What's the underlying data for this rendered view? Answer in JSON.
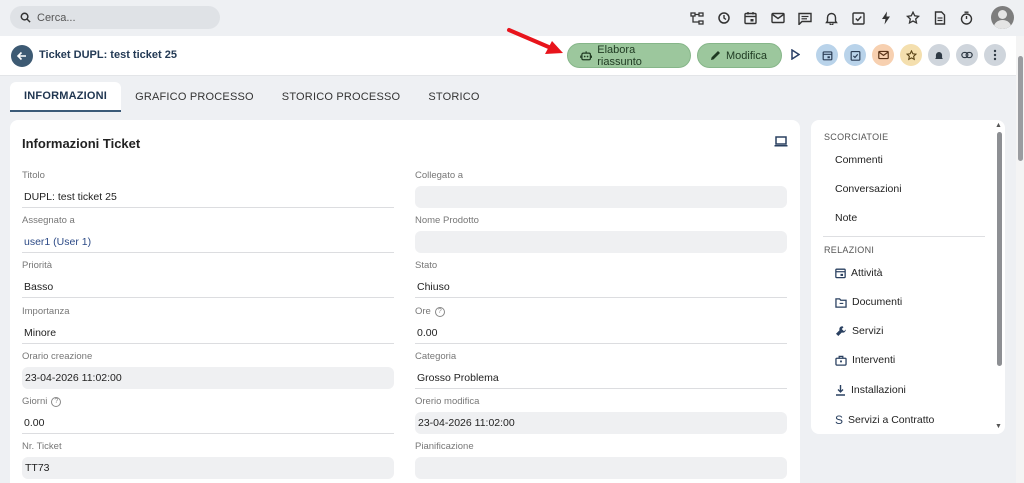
{
  "topbar": {
    "search_placeholder": "Cerca...",
    "icons": [
      "sitemap-icon",
      "history-icon",
      "calendar-icon",
      "mail-icon",
      "chat-icon",
      "bell-icon",
      "task-check-icon",
      "bolt-icon",
      "star-icon",
      "document-icon",
      "timer-icon"
    ]
  },
  "header": {
    "title": "Ticket DUPL: test ticket 25",
    "summary_button": "Elabora riassunto",
    "edit_button": "Modifica"
  },
  "tabs": [
    "INFORMAZIONI",
    "GRAFICO PROCESSO",
    "STORICO PROCESSO",
    "STORICO"
  ],
  "card": {
    "title": "Informazioni Ticket",
    "left_fields": [
      {
        "label": "Titolo",
        "value": "DUPL: test ticket 25"
      },
      {
        "label": "Assegnato a",
        "value": "user1 (User 1)"
      },
      {
        "label": "Priorità",
        "value": "Basso"
      },
      {
        "label": "Importanza",
        "value": "Minore"
      },
      {
        "label": "Orario creazione",
        "value": "23-04-2026 11:02:00"
      },
      {
        "label": "Giorni",
        "value": "0.00"
      },
      {
        "label": "Nr. Ticket",
        "value": "TT73"
      }
    ],
    "right_fields": [
      {
        "label": "Collegato a",
        "value": ""
      },
      {
        "label": "Nome Prodotto",
        "value": ""
      },
      {
        "label": "Stato",
        "value": "Chiuso"
      },
      {
        "label": "Ore",
        "value": "0.00"
      },
      {
        "label": "Categoria",
        "value": "Grosso Problema"
      },
      {
        "label": "Orerio modifica",
        "value": "23-04-2026 11:02:00"
      },
      {
        "label": "Pianificazione",
        "value": ""
      }
    ]
  },
  "side": {
    "shortcuts_title": "SCORCIATOIE",
    "shortcuts": [
      "Commenti",
      "Conversazioni",
      "Note"
    ],
    "relations_title": "RELAZIONI",
    "relations": [
      "Attività",
      "Documenti",
      "Servizi",
      "Interventi",
      "Installazioni",
      "Servizi a Contratto"
    ]
  },
  "colors": {
    "accent_green": "#9cc79d",
    "header_dark": "#3d5a73",
    "annotation_red": "#e8141c"
  }
}
